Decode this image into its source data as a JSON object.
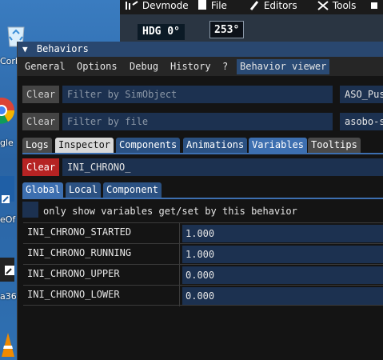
{
  "sim": {
    "devmode": "Devmode",
    "file": "File",
    "editors": "Editors",
    "tools": "Tools",
    "hdg": "HDG 0°",
    "heading": "253°"
  },
  "desktop": {
    "labels": [
      "Corb",
      "gle",
      "eOf",
      "a36"
    ]
  },
  "window": {
    "title": "Behaviors",
    "menu": [
      "General",
      "Options",
      "Debug",
      "History",
      "?",
      "Behavior viewer"
    ]
  },
  "filters": {
    "clear_label": "Clear",
    "simobject_placeholder": "Filter by SimObject",
    "simobject_value": "ASO_Pus",
    "file_placeholder": "Filter by file",
    "file_value": "asobo-s"
  },
  "tabs": [
    "Logs",
    "Inspector",
    "Components",
    "Animations",
    "Variables",
    "Tooltips"
  ],
  "variables": {
    "clear_label": "Clear",
    "search_value": "INI_CHRONO_",
    "scope_tabs": [
      "Global",
      "Local",
      "Component"
    ],
    "only_show_label": "only show variables get/set by this behavior",
    "rows": [
      {
        "name": "INI_CHRONO_STARTED",
        "value": "1.000"
      },
      {
        "name": "INI_CHRONO_RUNNING",
        "value": "1.000"
      },
      {
        "name": "INI_CHRONO_UPPER",
        "value": "0.000"
      },
      {
        "name": "INI_CHRONO_LOWER",
        "value": "0.000"
      }
    ]
  }
}
